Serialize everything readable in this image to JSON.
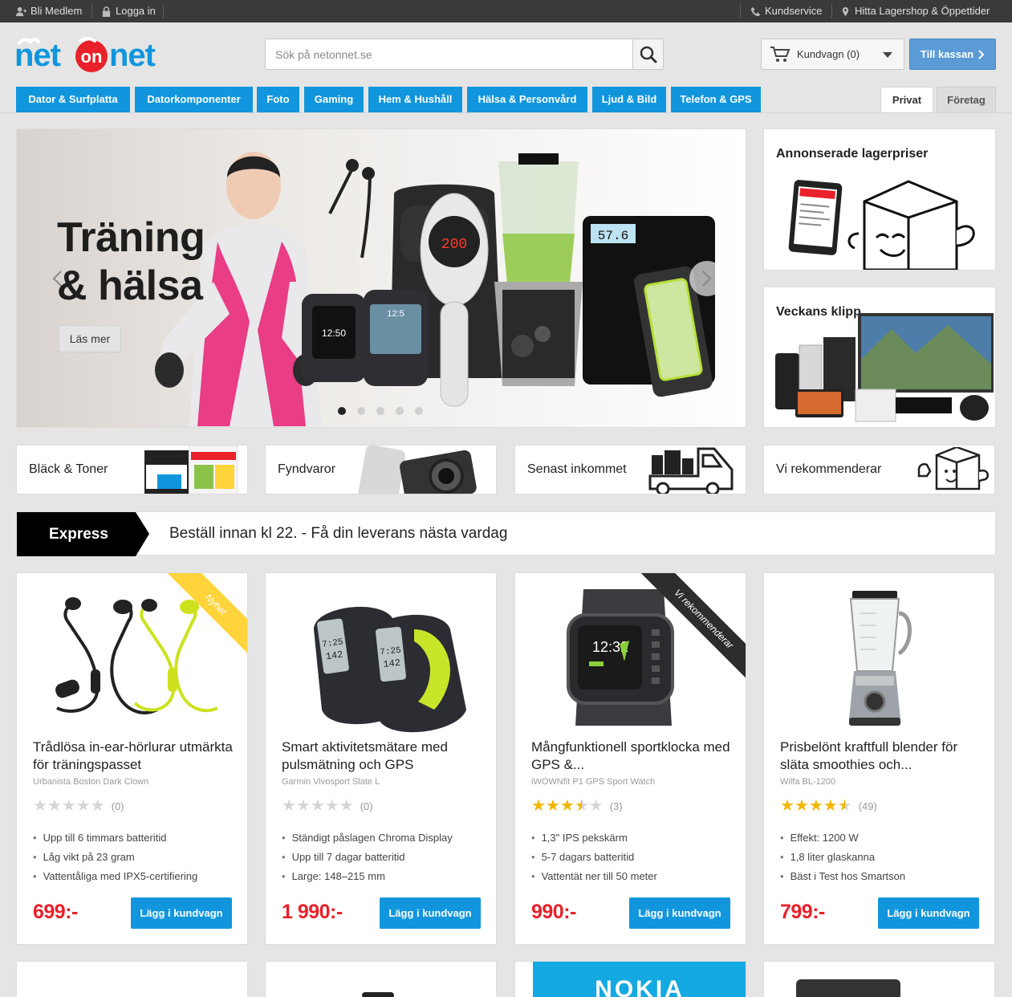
{
  "topbar": {
    "member": "Bli Medlem",
    "login": "Logga in",
    "support": "Kundservice",
    "stores": "Hitta Lagershop & Öppettider"
  },
  "logo": {
    "part1": "net",
    "part2": "on",
    "part3": "net"
  },
  "search": {
    "placeholder": "Sök på netonnet.se"
  },
  "cart": {
    "label": "Kundvagn (0)",
    "checkout": "Till kassan"
  },
  "categories": [
    "Dator & Surfplatta",
    "Datorkomponenter",
    "Foto",
    "Gaming",
    "Hem & Hushåll",
    "Hälsa & Personvård",
    "Ljud & Bild",
    "Telefon & GPS"
  ],
  "segments": {
    "private": "Privat",
    "business": "Företag"
  },
  "hero": {
    "title_line1": "Träning",
    "title_line2": "& hälsa",
    "cta": "Läs mer",
    "display1": "200",
    "display2": "57.6",
    "slides": 5,
    "active_slide": 1
  },
  "side_promos": [
    {
      "title": "Annonserade lagerpriser"
    },
    {
      "title": "Veckans klipp"
    }
  ],
  "quick_links": [
    "Bläck & Toner",
    "Fyndvaror",
    "Senast inkommet",
    "Vi rekommenderar"
  ],
  "express": {
    "tag": "Express",
    "message": "Beställ innan kl 22. - Få din leverans nästa vardag"
  },
  "products": [
    {
      "name": "Trådlösa in-ear-hörlurar utmärkta för träningspasset",
      "subtitle": "Urbanista Boston Dark Clown",
      "rating": 0,
      "reviews": "(0)",
      "features": [
        "Upp till 6 timmars batteritid",
        "Låg vikt på 23 gram",
        "Vattentåliga med IPX5-certifiering"
      ],
      "price": "699:-",
      "button": "Lägg i kundvagn",
      "badge": "Nyhet"
    },
    {
      "name": "Smart aktivitetsmätare med pulsmätning och GPS",
      "subtitle": "Garmin Vivosport Slate L",
      "rating": 0,
      "reviews": "(0)",
      "features": [
        "Ständigt påslagen Chroma Display",
        "Upp till 7 dagar batteritid",
        "Large: 148–215 mm"
      ],
      "price": "1 990:-",
      "button": "Lägg i kundvagn",
      "badge": ""
    },
    {
      "name": "Mångfunktionell sportklocka med GPS &...",
      "subtitle": "iWOWNfit P1 GPS Sport Watch",
      "rating": 3.5,
      "reviews": "(3)",
      "features": [
        "1,3\" IPS pekskärm",
        "5-7 dagars batteritid",
        "Vattentät ner till 50 meter"
      ],
      "price": "990:-",
      "button": "Lägg i kundvagn",
      "badge": "Vi rekommenderar",
      "watch_time": "12:32"
    },
    {
      "name": "Prisbelönt kraftfull blender för släta smoothies och...",
      "subtitle": "Wilfa BL-1200",
      "rating": 4.5,
      "reviews": "(49)",
      "features": [
        "Effekt: 1200 W",
        "1,8 liter glaskanna",
        "Bäst i Test hos Smartson"
      ],
      "price": "799:-",
      "button": "Lägg i kundvagn",
      "badge": ""
    }
  ],
  "partial_products": [
    {
      "brand": ""
    },
    {
      "brand": ""
    },
    {
      "brand": "NOKIA"
    },
    {
      "brand": ""
    }
  ],
  "colors": {
    "category_blue": "#1196dd",
    "price_red": "#e8212a",
    "checkout_blue": "#5b9bd5",
    "star_gold": "#f2b600",
    "ribbon_yellow": "#ffd43b"
  }
}
